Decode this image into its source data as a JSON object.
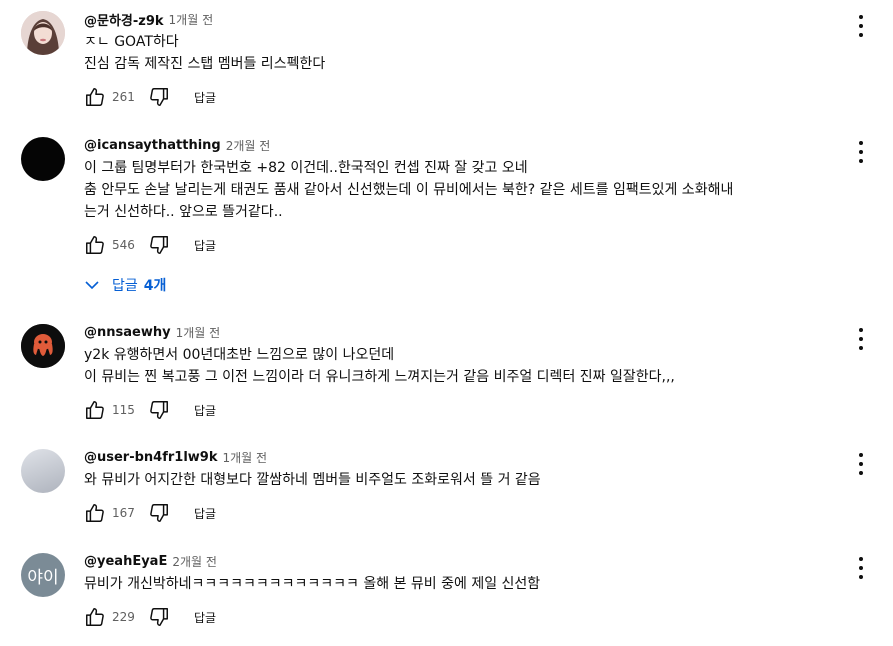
{
  "comments": [
    {
      "author": "@문하경-z9k",
      "time": "1개월 전",
      "lines": [
        "ㅈㄴ GOAT하다",
        "진심 감독 제작진 스탭 멤버들 리스펙한다"
      ],
      "likes": "261",
      "reply_label": "답글",
      "avatar_color": "#d9c2c0",
      "avatar_text": ""
    },
    {
      "author": "@icansaythatthing",
      "time": "2개월 전",
      "lines": [
        "이 그룹 팀명부터가 한국번호 +82 이건데..한국적인 컨셉 진짜 잘 갖고 오네",
        "춤 안무도 손날 날리는게 태권도 품새 같아서 신선했는데 이 뮤비에서는 북한? 같은 세트를 임팩트있게 소화해내",
        "는거 신선하다.. 앞으로 뜰거같다.."
      ],
      "likes": "546",
      "reply_label": "답글",
      "avatar_color": "#050505",
      "avatar_text": "",
      "replies_toggle": {
        "label": "답글",
        "count": "4개"
      }
    },
    {
      "author": "@nnsaewhy",
      "time": "1개월 전",
      "lines": [
        "y2k 유행하면서 00년대초반 느낌으로 많이 나오던데",
        "이 뮤비는 찐 복고풍 그 이전 느낌이라 더 유니크하게 느껴지는거 같음 비주얼 디렉터 진짜 일잘한다,,,"
      ],
      "likes": "115",
      "reply_label": "답글",
      "avatar_color": "#0d0d0d",
      "avatar_text": ""
    },
    {
      "author": "@user-bn4fr1lw9k",
      "time": "1개월 전",
      "lines": [
        "와 뮤비가 어지간한 대형보다 깔쌈하네 멤버들 비주얼도 조화로워서 뜰 거 같음"
      ],
      "likes": "167",
      "reply_label": "답글",
      "avatar_color": "#c7cbd3",
      "avatar_text": ""
    },
    {
      "author": "@yeahEyaE",
      "time": "2개월 전",
      "lines": [
        "뮤비가 개신박하네ㅋㅋㅋㅋㅋㅋㅋㅋㅋㅋㅋㅋㅋ 올해 본 뮤비 중에 제일 신선함"
      ],
      "likes": "229",
      "reply_label": "답글",
      "avatar_color": "#7b8b96",
      "avatar_text": "야이"
    }
  ]
}
